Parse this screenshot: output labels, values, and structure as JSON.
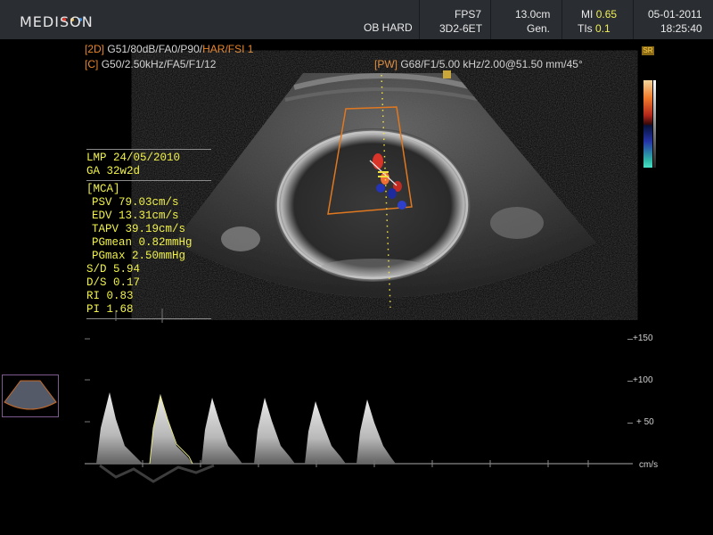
{
  "header": {
    "brand": "MEDISON",
    "preset": "OB HARD",
    "fps": "FPS7",
    "probe": "3D2-6ET",
    "depth": "13.0cm",
    "freq_mode": "Gen.",
    "mi_label": "MI",
    "mi_value": "0.65",
    "tis_label": "TIs",
    "tis_value": "0.1",
    "date": "05-01-2011",
    "time": "18:25:40"
  },
  "params": {
    "twod_tag": "[2D]",
    "twod_a": "G51/80dB/FA0/P90/",
    "twod_b": "HAR/FSI 1",
    "color_tag": "[C]",
    "color_text": "G50/2.50kHz/FA5/F1/12",
    "pw_tag": "[PW]",
    "pw_text": "G68/F1/5.00 kHz/2.00@51.50 mm/45°"
  },
  "measurements": {
    "lmp": "LMP 24/05/2010",
    "ga": "GA  32w2d",
    "vessel": "[MCA]",
    "psv": "PSV 79.03cm/s",
    "edv": "EDV 13.31cm/s",
    "tapv": "TAPV 39.19cm/s",
    "pgmean": "PGmean 0.82mmHg",
    "pgmax": "PGmax 2.50mmHg",
    "sd": "S/D 5.94",
    "ds": "D/S 0.17",
    "ri": "RI  0.83",
    "pi": "PI  1.68"
  },
  "doppler_scale": {
    "labels": [
      "+150",
      "+100",
      "+ 50"
    ],
    "unit": "cm/s"
  },
  "side_badge": "SR",
  "colors": {
    "accent_orange": "#e7862a",
    "measure_yellow": "#f1f24a",
    "header_bg": "#2a2d31"
  }
}
